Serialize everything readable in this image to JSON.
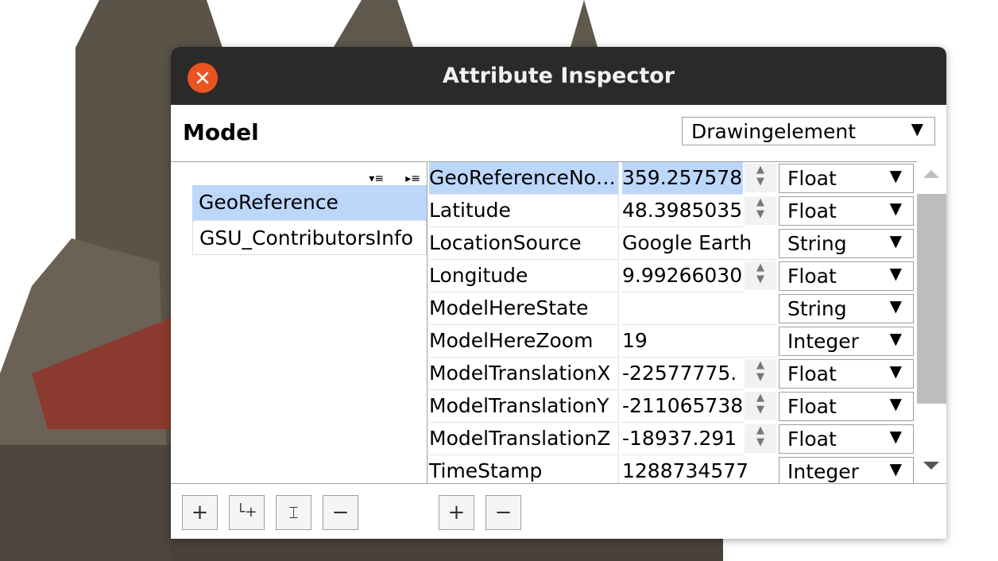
{
  "window": {
    "title": "Attribute Inspector"
  },
  "header": {
    "label": "Model",
    "type_select": "Drawingelement"
  },
  "tree": {
    "items": [
      {
        "label": "GeoReference",
        "selected": true
      },
      {
        "label": "GSU_ContributorsInfo",
        "selected": false
      }
    ]
  },
  "attributes": [
    {
      "name": "GeoReferenceNo…",
      "value": "359.257578",
      "type": "Float",
      "spinner": true
    },
    {
      "name": "Latitude",
      "value": "48.3985035",
      "type": "Float",
      "spinner": true
    },
    {
      "name": "LocationSource",
      "value": "Google Earth",
      "type": "String",
      "spinner": false
    },
    {
      "name": "Longitude",
      "value": "9.99266030",
      "type": "Float",
      "spinner": true
    },
    {
      "name": "ModelHereState",
      "value": "",
      "type": "String",
      "spinner": false
    },
    {
      "name": "ModelHereZoom",
      "value": "19",
      "type": "Integer",
      "spinner": false
    },
    {
      "name": "ModelTranslationX",
      "value": "-22577775.",
      "type": "Float",
      "spinner": true
    },
    {
      "name": "ModelTranslationY",
      "value": "-211065738",
      "type": "Float",
      "spinner": true
    },
    {
      "name": "ModelTranslationZ",
      "value": "-18937.291",
      "type": "Float",
      "spinner": true
    },
    {
      "name": "TimeStamp",
      "value": "1288734577",
      "type": "Integer",
      "spinner": false
    }
  ],
  "toolbar": {
    "tree_buttons": [
      "+",
      "└+",
      "⌶",
      "−"
    ],
    "attr_buttons": [
      "+",
      "−"
    ]
  },
  "colors": {
    "titlebar": "#2c2a29",
    "close": "#e95420",
    "selection": "#bdd7fb"
  }
}
